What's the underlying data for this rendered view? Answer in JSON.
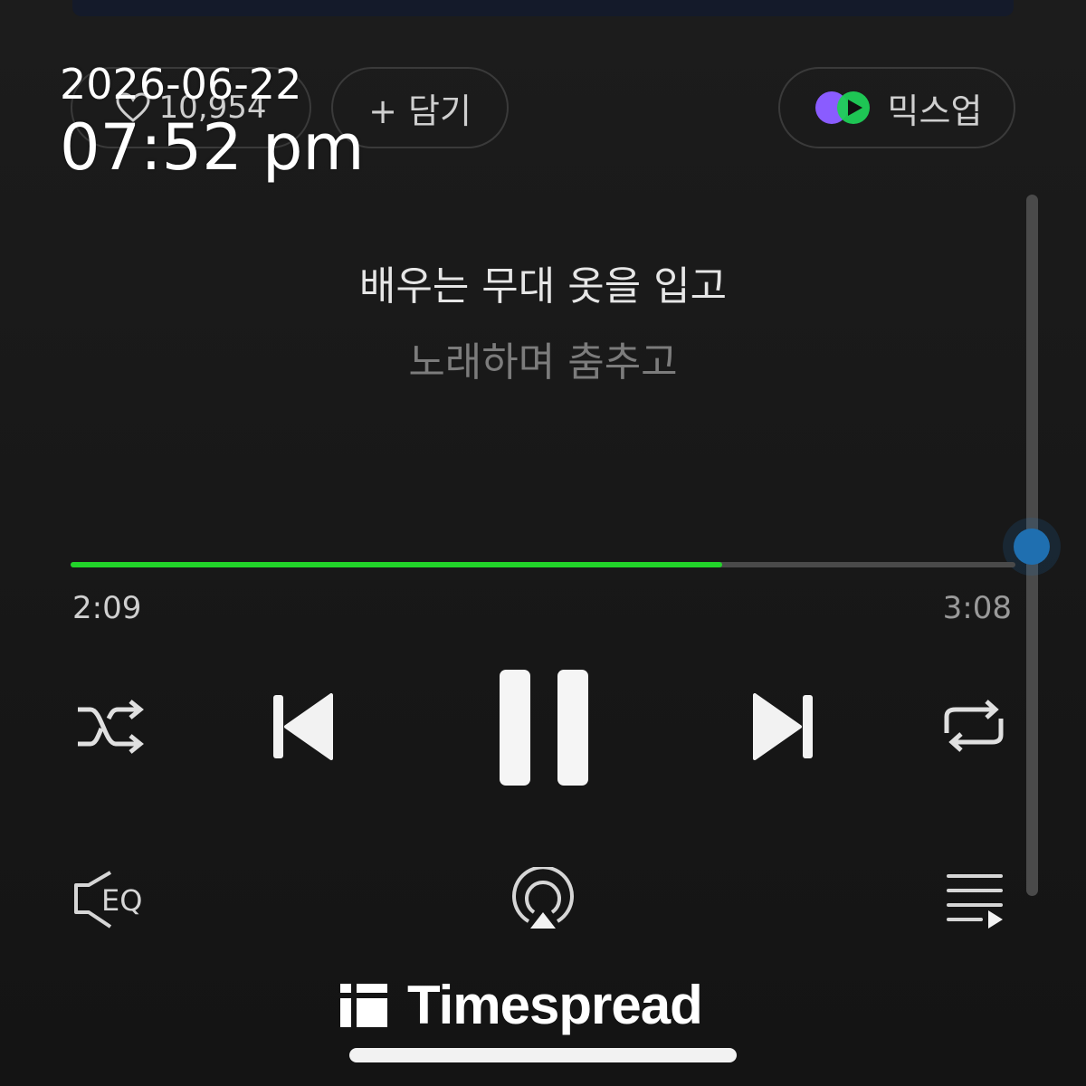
{
  "top": {
    "like_count": "10,954",
    "add_label": "+ 담기",
    "mixup_label": "믹스업"
  },
  "timestamp": {
    "date": "2026-06-22",
    "time": "07:52 pm"
  },
  "lyrics": {
    "current": "배우는 무대 옷을 입고",
    "next": "노래하며 춤추고"
  },
  "player": {
    "elapsed": "2:09",
    "duration": "3:08",
    "progress_fraction": 0.69,
    "accent_color": "#22d42a"
  },
  "controls": {
    "icons": [
      "shuffle-icon",
      "previous-icon",
      "pause-icon",
      "next-icon",
      "repeat-icon"
    ],
    "bottom_icons": [
      "equalizer-icon",
      "airplay-icon",
      "playlist-icon"
    ]
  },
  "brand": {
    "name": "Timespread"
  }
}
